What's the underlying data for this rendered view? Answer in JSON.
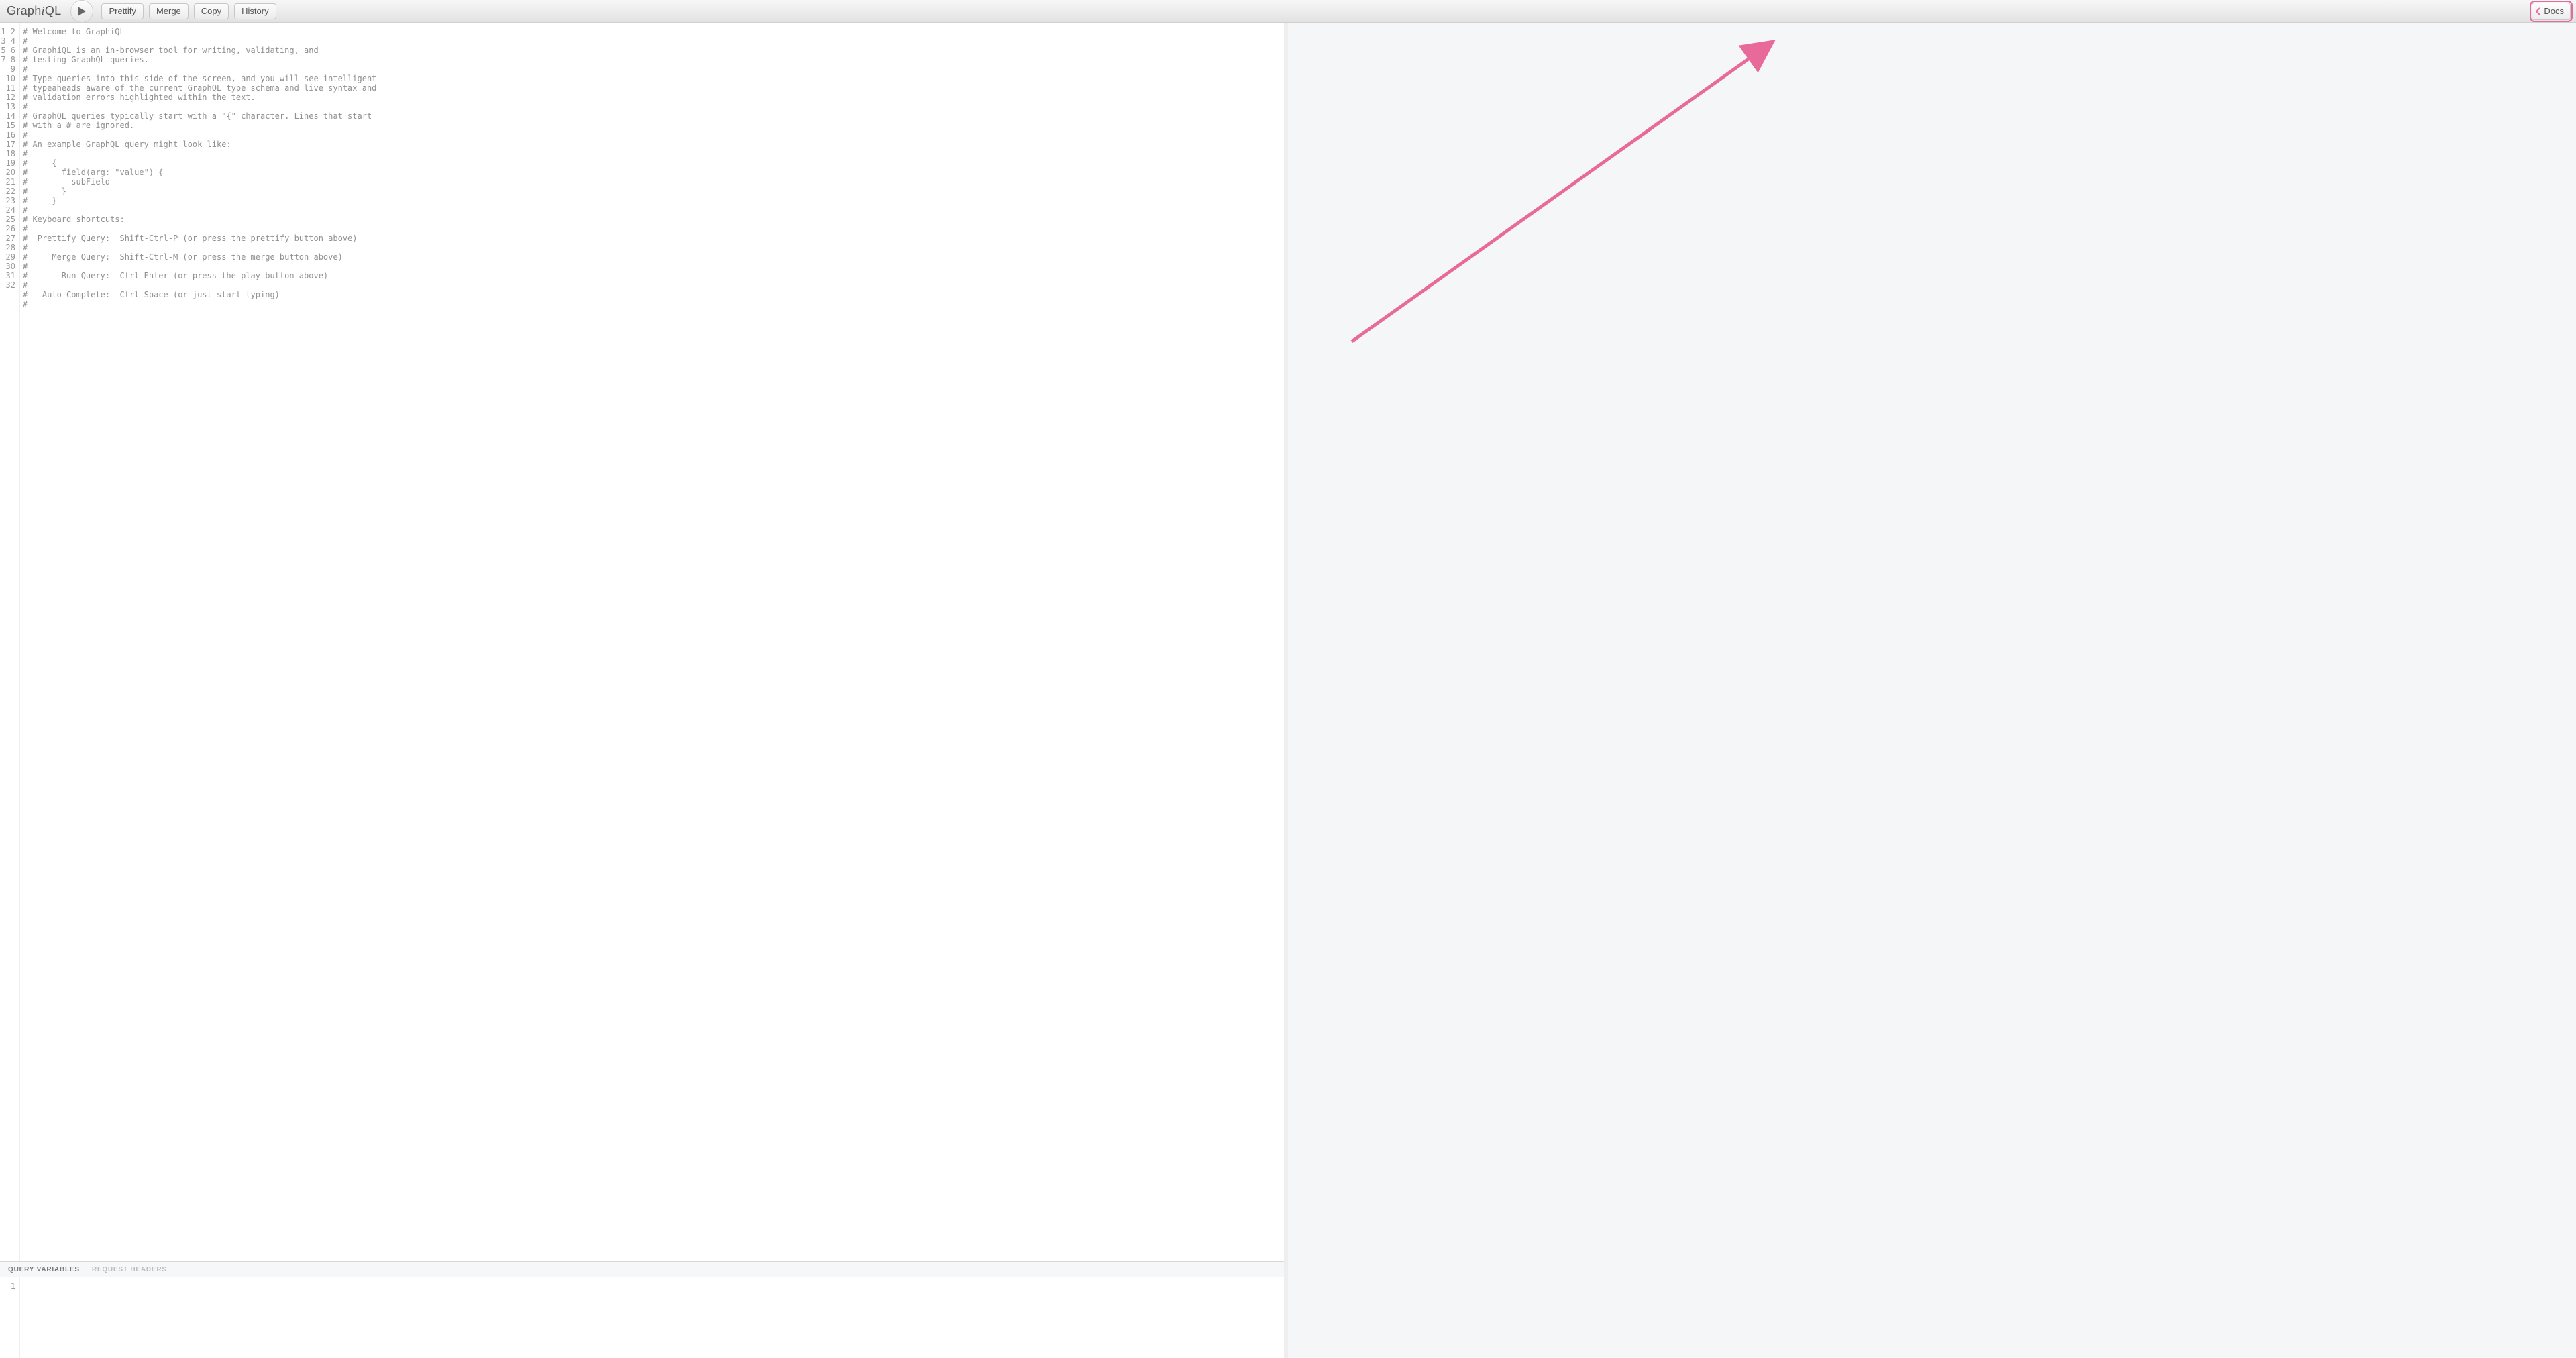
{
  "app": {
    "title_plain": "Graph",
    "title_italic": "i",
    "title_tail": "QL"
  },
  "toolbar": {
    "prettify": "Prettify",
    "merge": "Merge",
    "copy": "Copy",
    "history": "History",
    "docs": "Docs"
  },
  "editor": {
    "lines": [
      "# Welcome to GraphiQL",
      "#",
      "# GraphiQL is an in-browser tool for writing, validating, and",
      "# testing GraphQL queries.",
      "#",
      "# Type queries into this side of the screen, and you will see intelligent",
      "# typeaheads aware of the current GraphQL type schema and live syntax and",
      "# validation errors highlighted within the text.",
      "#",
      "# GraphQL queries typically start with a \"{\" character. Lines that start",
      "# with a # are ignored.",
      "#",
      "# An example GraphQL query might look like:",
      "#",
      "#     {",
      "#       field(arg: \"value\") {",
      "#         subField",
      "#       }",
      "#     }",
      "#",
      "# Keyboard shortcuts:",
      "#",
      "#  Prettify Query:  Shift-Ctrl-P (or press the prettify button above)",
      "#",
      "#     Merge Query:  Shift-Ctrl-M (or press the merge button above)",
      "#",
      "#       Run Query:  Ctrl-Enter (or press the play button above)",
      "#",
      "#   Auto Complete:  Ctrl-Space (or just start typing)",
      "#",
      "",
      ""
    ]
  },
  "bottom": {
    "query_variables": "QUERY VARIABLES",
    "request_headers": "REQUEST HEADERS",
    "vars_lines": [
      ""
    ]
  }
}
